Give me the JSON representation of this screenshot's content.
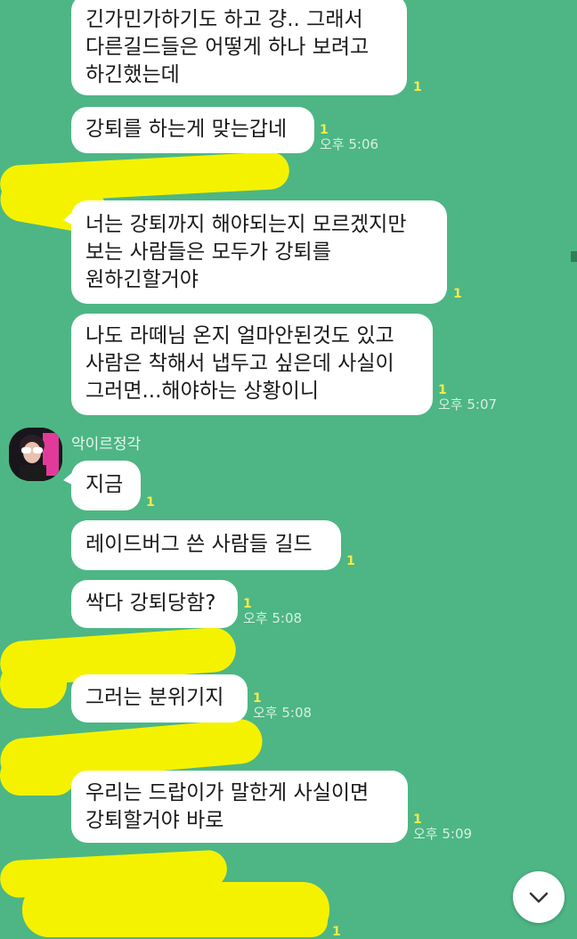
{
  "messages": [
    {
      "text": "긴가민가하기도 하고 걍.. 그래서\n다른길드들은 어떻게 하나 보려고\n하긴했는데",
      "unread": "1",
      "time": ""
    },
    {
      "text": "강퇴를 하는게 맞는갑네",
      "unread": "1",
      "time": "오후 5:06"
    },
    {
      "text": "너는 강퇴까지 해야되는지 모르겠지만\n보는 사람들은 모두가 강퇴를\n원하긴할거야",
      "unread": "1",
      "time": ""
    },
    {
      "text": "나도 라떼님 온지 얼마안된것도 있고\n사람은 착해서 냅두고 싶은데 사실이\n그러면...해야하는 상황이니",
      "unread": "1",
      "time": "오후 5:07"
    },
    {
      "text": "지금",
      "unread": "1",
      "time": ""
    },
    {
      "text": "레이드버그 쓴 사람들 길드",
      "unread": "1",
      "time": ""
    },
    {
      "text": "싹다 강퇴당함?",
      "unread": "1",
      "time": "오후 5:08"
    },
    {
      "text": "그러는 분위기지",
      "unread": "1",
      "time": "오후 5:08"
    },
    {
      "text": "우리는 드랍이가 말한게 사실이면\n강퇴할거야 바로",
      "unread": "1",
      "time": "오후 5:09"
    },
    {
      "text": "",
      "unread": "1",
      "time": ""
    }
  ],
  "sender": {
    "name": "악이르정각"
  },
  "colors": {
    "background": "#4db684",
    "bubble": "#ffffff",
    "unread": "#f7ea4a",
    "scribble": "#f5f200"
  },
  "icons": {
    "scroll_down": "chevron-down-icon",
    "avatar": "avatar"
  }
}
